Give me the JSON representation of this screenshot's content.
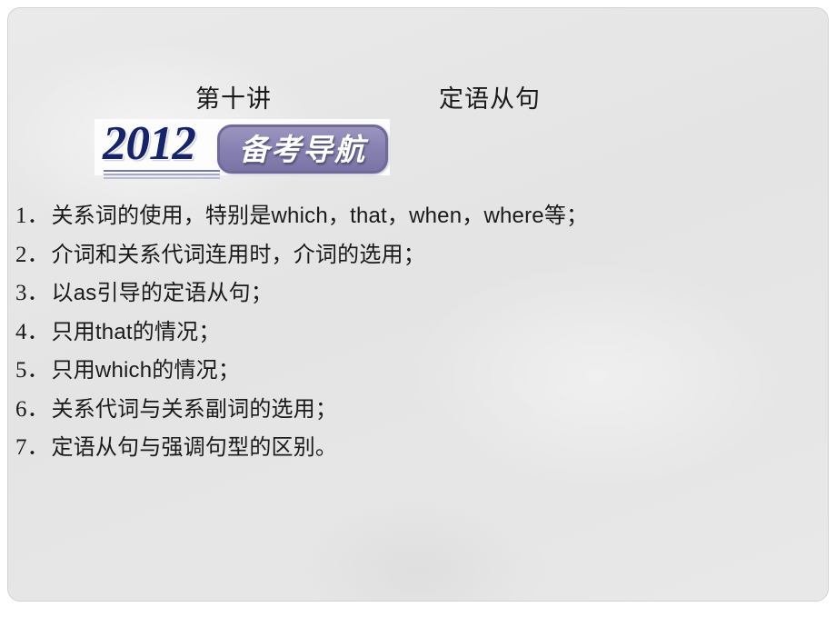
{
  "slide": {
    "background_color": "#e6e6e6",
    "title": {
      "main": "第十讲",
      "sub": "定语从句"
    },
    "logo": {
      "year": "2012",
      "badge_text": "备考导航",
      "badge_color": "#8883b2",
      "year_color": "#16246e"
    },
    "list": [
      {
        "num": "1．",
        "text": "关系词的使用，特别是which，that，when，where等；"
      },
      {
        "num": "2．",
        "text": "介词和关系代词连用时，介词的选用；"
      },
      {
        "num": "3．",
        "text": "以as引导的定语从句；"
      },
      {
        "num": "4．",
        "text": "只用that的情况；"
      },
      {
        "num": "5．",
        "text": "只用which的情况；"
      },
      {
        "num": "6．",
        "text": "关系代词与关系副词的选用；"
      },
      {
        "num": "7．",
        "text": "定语从句与强调句型的区别。"
      }
    ]
  }
}
